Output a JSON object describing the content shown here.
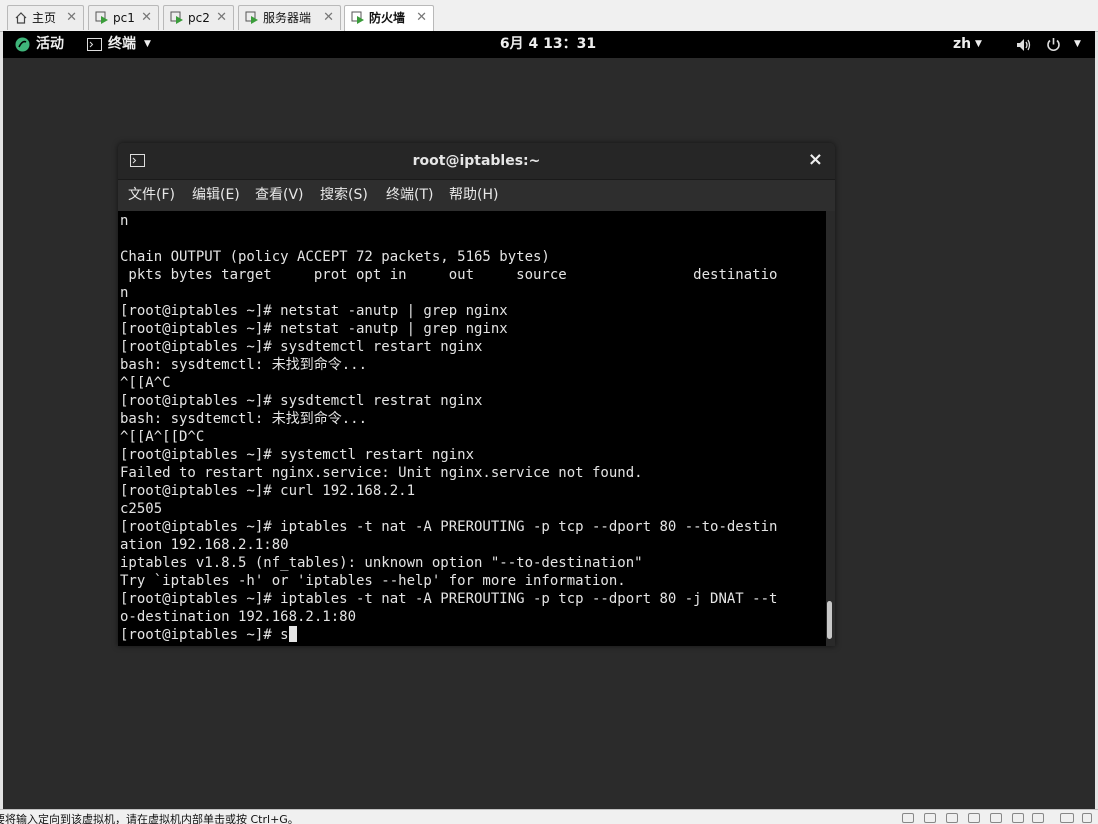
{
  "tabs": [
    {
      "label": "主页",
      "icon": "home-icon",
      "active": false
    },
    {
      "label": "pc1",
      "icon": "vm-icon",
      "active": false
    },
    {
      "label": "pc2",
      "icon": "vm-icon",
      "active": false
    },
    {
      "label": "服务器端",
      "icon": "vm-icon",
      "active": false
    },
    {
      "label": "防火墙",
      "icon": "vm-icon",
      "active": true
    }
  ],
  "tab_close": "✕",
  "topbar": {
    "activities": "活动",
    "app_name": "终端",
    "clock": "6月 4 13：31",
    "language": "zh"
  },
  "terminal": {
    "title": "root@iptables:~",
    "close_symbol": "×",
    "menu": [
      "文件(F)",
      "编辑(E)",
      "查看(V)",
      "搜索(S)",
      "终端(T)",
      "帮助(H)"
    ],
    "lines": [
      "n",
      "",
      "Chain OUTPUT (policy ACCEPT 72 packets, 5165 bytes)",
      " pkts bytes target     prot opt in     out     source               destinatio",
      "n",
      "[root@iptables ~]# netstat -anutp | grep nginx",
      "[root@iptables ~]# netstat -anutp | grep nginx",
      "[root@iptables ~]# sysdtemctl restart nginx",
      "bash: sysdtemctl: 未找到命令...",
      "^[[A^C",
      "[root@iptables ~]# sysdtemctl restrat nginx",
      "bash: sysdtemctl: 未找到命令...",
      "^[[A^[[D^C",
      "[root@iptables ~]# systemctl restart nginx",
      "Failed to restart nginx.service: Unit nginx.service not found.",
      "[root@iptables ~]# curl 192.168.2.1",
      "c2505",
      "[root@iptables ~]# iptables -t nat -A PREROUTING -p tcp --dport 80 --to-destin",
      "ation 192.168.2.1:80",
      "iptables v1.8.5 (nf_tables): unknown option \"--to-destination\"",
      "Try `iptables -h' or 'iptables --help' for more information.",
      "[root@iptables ~]# iptables -t nat -A PREROUTING -p tcp --dport 80 -j DNAT --t",
      "o-destination 192.168.2.1:80"
    ],
    "prompt_line": "[root@iptables ~]# s"
  },
  "statusbar": {
    "hint": "要将输入定向到该虚拟机，请在虚拟机内部单击或按 Ctrl+G。"
  },
  "colors": {
    "terminal_bg": "#000000",
    "terminal_fg": "#e4e4e4",
    "topbar_bg": "#000000",
    "accent_green": "#3fb57a"
  }
}
